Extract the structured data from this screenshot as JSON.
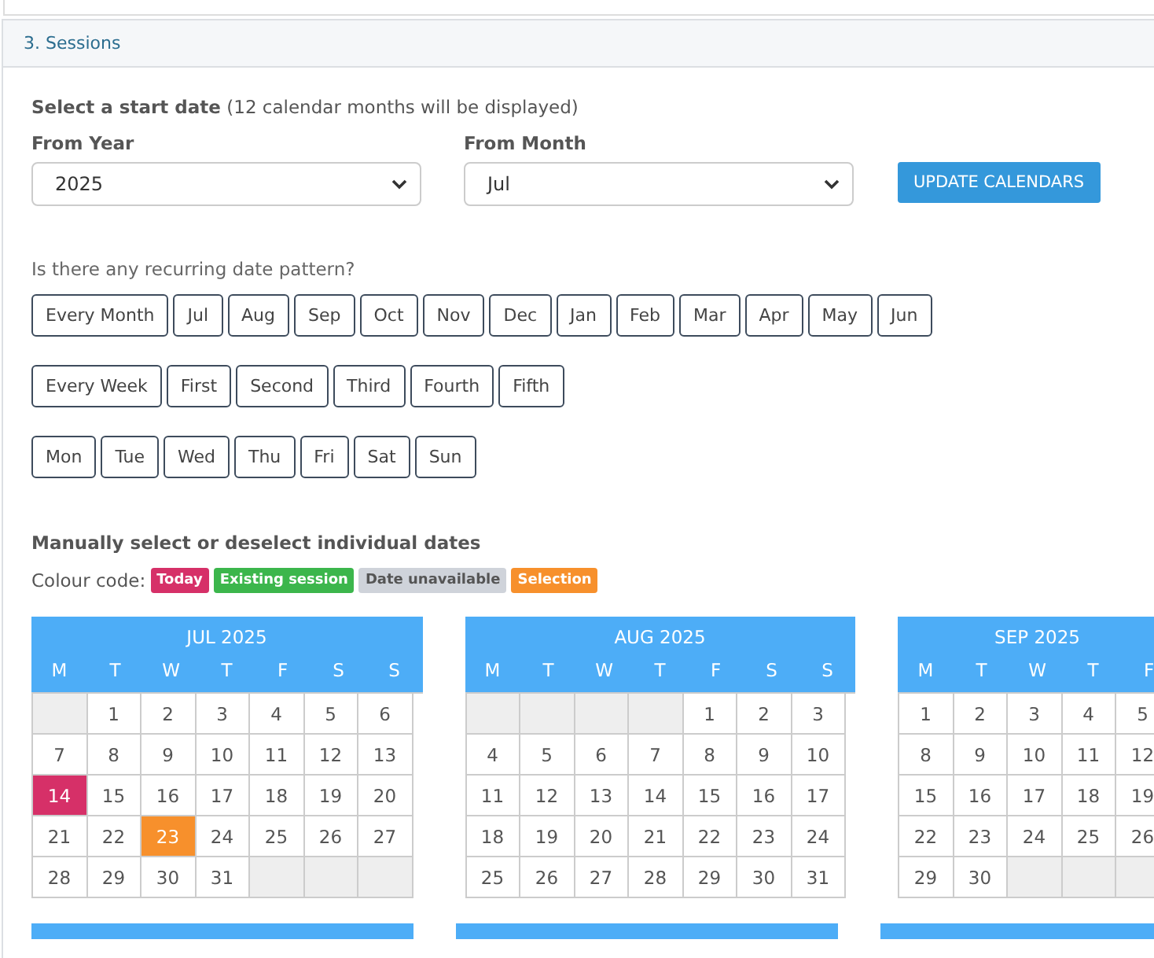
{
  "panel": {
    "title": "3. Sessions"
  },
  "start": {
    "heading": "Select a start date",
    "note": "(12 calendar months will be displayed)",
    "fields": [
      {
        "label": "From Year",
        "value": "2025"
      },
      {
        "label": "From Month",
        "value": "Jul"
      }
    ],
    "button": "UPDATE CALENDARS"
  },
  "recurring": {
    "question": "Is there any recurring date pattern?",
    "groups": [
      [
        {
          "label": "Every Month",
          "selected": false
        },
        {
          "label": "Jul",
          "selected": false
        },
        {
          "label": "Aug",
          "selected": false
        },
        {
          "label": "Sep",
          "selected": false
        },
        {
          "label": "Oct",
          "selected": false
        },
        {
          "label": "Nov",
          "selected": false
        },
        {
          "label": "Dec",
          "selected": false
        },
        {
          "label": "Jan",
          "selected": false
        },
        {
          "label": "Feb",
          "selected": false
        },
        {
          "label": "Mar",
          "selected": false
        },
        {
          "label": "Apr",
          "selected": false
        },
        {
          "label": "May",
          "selected": false
        },
        {
          "label": "Jun",
          "selected": false
        }
      ],
      [
        {
          "label": "Every Week",
          "selected": false
        },
        {
          "label": "First",
          "selected": false
        },
        {
          "label": "Second",
          "selected": false
        },
        {
          "label": "Third",
          "selected": false
        },
        {
          "label": "Fourth",
          "selected": false
        },
        {
          "label": "Fifth",
          "selected": false
        }
      ],
      [
        {
          "label": "Mon",
          "selected": false
        },
        {
          "label": "Tue",
          "selected": false
        },
        {
          "label": "Wed",
          "selected": false
        },
        {
          "label": "Thu",
          "selected": false
        },
        {
          "label": "Fri",
          "selected": false
        },
        {
          "label": "Sat",
          "selected": false
        },
        {
          "label": "Sun",
          "selected": false
        }
      ]
    ]
  },
  "manual": {
    "heading": "Manually select or deselect individual dates",
    "legend_label": "Colour code:",
    "legend": [
      {
        "label": "Today",
        "color": "#d63068"
      },
      {
        "label": "Existing session",
        "color": "#3cb64c"
      },
      {
        "label": "Date unavailable",
        "color": "#cfd3da"
      },
      {
        "label": "Selection",
        "color": "#f7902c"
      }
    ]
  },
  "calendars": [
    {
      "title": "JUL 2025",
      "weekdays": [
        "M",
        "T",
        "W",
        "T",
        "F",
        "S",
        "S"
      ],
      "weeks": [
        [
          {
            "kind": "empty"
          },
          {
            "kind": "day",
            "day": "1"
          },
          {
            "kind": "day",
            "day": "2"
          },
          {
            "kind": "day",
            "day": "3"
          },
          {
            "kind": "day",
            "day": "4"
          },
          {
            "kind": "day",
            "day": "5"
          },
          {
            "kind": "day",
            "day": "6"
          }
        ],
        [
          {
            "kind": "day",
            "day": "7"
          },
          {
            "kind": "day",
            "day": "8"
          },
          {
            "kind": "day",
            "day": "9"
          },
          {
            "kind": "day",
            "day": "10"
          },
          {
            "kind": "day",
            "day": "11"
          },
          {
            "kind": "day",
            "day": "12"
          },
          {
            "kind": "day",
            "day": "13"
          }
        ],
        [
          {
            "kind": "today",
            "day": "14"
          },
          {
            "kind": "day",
            "day": "15"
          },
          {
            "kind": "day",
            "day": "16"
          },
          {
            "kind": "day",
            "day": "17"
          },
          {
            "kind": "day",
            "day": "18"
          },
          {
            "kind": "day",
            "day": "19"
          },
          {
            "kind": "day",
            "day": "20"
          }
        ],
        [
          {
            "kind": "day",
            "day": "21"
          },
          {
            "kind": "day",
            "day": "22"
          },
          {
            "kind": "selection",
            "day": "23"
          },
          {
            "kind": "day",
            "day": "24"
          },
          {
            "kind": "day",
            "day": "25"
          },
          {
            "kind": "day",
            "day": "26"
          },
          {
            "kind": "day",
            "day": "27"
          }
        ],
        [
          {
            "kind": "day",
            "day": "28"
          },
          {
            "kind": "day",
            "day": "29"
          },
          {
            "kind": "day",
            "day": "30"
          },
          {
            "kind": "day",
            "day": "31"
          },
          {
            "kind": "empty"
          },
          {
            "kind": "empty"
          },
          {
            "kind": "empty"
          }
        ]
      ]
    },
    {
      "title": "AUG 2025",
      "weekdays": [
        "M",
        "T",
        "W",
        "T",
        "F",
        "S",
        "S"
      ],
      "weeks": [
        [
          {
            "kind": "empty"
          },
          {
            "kind": "empty"
          },
          {
            "kind": "empty"
          },
          {
            "kind": "empty"
          },
          {
            "kind": "day",
            "day": "1"
          },
          {
            "kind": "day",
            "day": "2"
          },
          {
            "kind": "day",
            "day": "3"
          }
        ],
        [
          {
            "kind": "day",
            "day": "4"
          },
          {
            "kind": "day",
            "day": "5"
          },
          {
            "kind": "day",
            "day": "6"
          },
          {
            "kind": "day",
            "day": "7"
          },
          {
            "kind": "day",
            "day": "8"
          },
          {
            "kind": "day",
            "day": "9"
          },
          {
            "kind": "day",
            "day": "10"
          }
        ],
        [
          {
            "kind": "day",
            "day": "11"
          },
          {
            "kind": "day",
            "day": "12"
          },
          {
            "kind": "day",
            "day": "13"
          },
          {
            "kind": "day",
            "day": "14"
          },
          {
            "kind": "day",
            "day": "15"
          },
          {
            "kind": "day",
            "day": "16"
          },
          {
            "kind": "day",
            "day": "17"
          }
        ],
        [
          {
            "kind": "day",
            "day": "18"
          },
          {
            "kind": "day",
            "day": "19"
          },
          {
            "kind": "day",
            "day": "20"
          },
          {
            "kind": "day",
            "day": "21"
          },
          {
            "kind": "day",
            "day": "22"
          },
          {
            "kind": "day",
            "day": "23"
          },
          {
            "kind": "day",
            "day": "24"
          }
        ],
        [
          {
            "kind": "day",
            "day": "25"
          },
          {
            "kind": "day",
            "day": "26"
          },
          {
            "kind": "day",
            "day": "27"
          },
          {
            "kind": "day",
            "day": "28"
          },
          {
            "kind": "day",
            "day": "29"
          },
          {
            "kind": "day",
            "day": "30"
          },
          {
            "kind": "day",
            "day": "31"
          }
        ]
      ]
    },
    {
      "title": "SEP 2025",
      "weekdays": [
        "M",
        "T",
        "W",
        "T",
        "F"
      ],
      "weeks": [
        [
          {
            "kind": "day",
            "day": "1"
          },
          {
            "kind": "day",
            "day": "2"
          },
          {
            "kind": "day",
            "day": "3"
          },
          {
            "kind": "day",
            "day": "4"
          },
          {
            "kind": "day",
            "day": "5"
          }
        ],
        [
          {
            "kind": "day",
            "day": "8"
          },
          {
            "kind": "day",
            "day": "9"
          },
          {
            "kind": "day",
            "day": "10"
          },
          {
            "kind": "day",
            "day": "11"
          },
          {
            "kind": "day",
            "day": "12"
          }
        ],
        [
          {
            "kind": "day",
            "day": "15"
          },
          {
            "kind": "day",
            "day": "16"
          },
          {
            "kind": "day",
            "day": "17"
          },
          {
            "kind": "day",
            "day": "18"
          },
          {
            "kind": "day",
            "day": "19"
          }
        ],
        [
          {
            "kind": "day",
            "day": "22"
          },
          {
            "kind": "day",
            "day": "23"
          },
          {
            "kind": "day",
            "day": "24"
          },
          {
            "kind": "day",
            "day": "25"
          },
          {
            "kind": "day",
            "day": "26"
          }
        ],
        [
          {
            "kind": "day",
            "day": "29"
          },
          {
            "kind": "day",
            "day": "30"
          },
          {
            "kind": "empty"
          },
          {
            "kind": "empty"
          },
          {
            "kind": "empty"
          }
        ]
      ]
    }
  ]
}
